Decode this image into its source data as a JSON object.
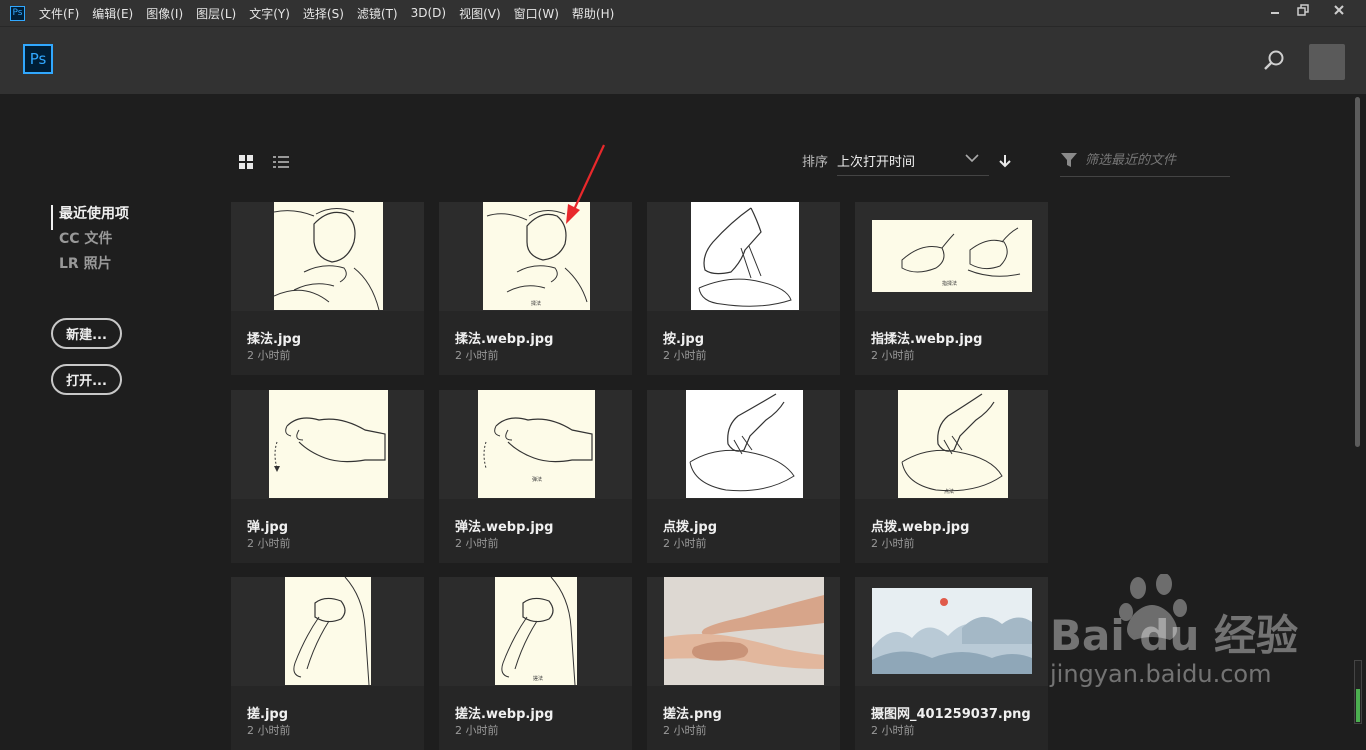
{
  "menubar": {
    "app_icon": "Ps",
    "items": [
      "文件(F)",
      "编辑(E)",
      "图像(I)",
      "图层(L)",
      "文字(Y)",
      "选择(S)",
      "滤镜(T)",
      "3D(D)",
      "视图(V)",
      "窗口(W)",
      "帮助(H)"
    ],
    "window_controls": [
      "minimize-icon",
      "restore-icon",
      "close-icon"
    ]
  },
  "header": {
    "logo": "Ps",
    "search_icon": "search-icon",
    "avatar": "user-avatar"
  },
  "sidebar": {
    "nav": [
      {
        "label": "最近使用项",
        "active": true
      },
      {
        "label": "CC 文件",
        "active": false
      },
      {
        "label": "LR 照片",
        "active": false
      }
    ],
    "new_button": "新建...",
    "open_button": "打开..."
  },
  "toolbar": {
    "view_modes": [
      "grid-view-icon",
      "list-view-icon"
    ],
    "active_view": "grid",
    "sort_label": "排序",
    "sort_value": "上次打开时间",
    "filter_placeholder": "筛选最近的文件"
  },
  "files": [
    {
      "name": "揉法.jpg",
      "time": "2 小时前"
    },
    {
      "name": "揉法.webp.jpg",
      "time": "2 小时前"
    },
    {
      "name": "按.jpg",
      "time": "2 小时前"
    },
    {
      "name": "指揉法.webp.jpg",
      "time": "2 小时前"
    },
    {
      "name": "弹.jpg",
      "time": "2 小时前"
    },
    {
      "name": "弹法.webp.jpg",
      "time": "2 小时前"
    },
    {
      "name": "点拨.jpg",
      "time": "2 小时前"
    },
    {
      "name": "点拨.webp.jpg",
      "time": "2 小时前"
    },
    {
      "name": "搓.jpg",
      "time": "2 小时前"
    },
    {
      "name": "搓法.webp.jpg",
      "time": "2 小时前"
    },
    {
      "name": "搓法.png",
      "time": "2 小时前"
    },
    {
      "name": "摄图网_401259037.png",
      "time": "2 小时前"
    }
  ],
  "thumb_captions": [
    "",
    "揉法",
    "",
    "指揉法",
    "",
    "弹法",
    "",
    "点法",
    "",
    "搓法",
    "",
    ""
  ],
  "watermark": {
    "brand": "Bai du 经验",
    "url": "jingyan.baidu.com"
  },
  "colors": {
    "accent": "#31a8ff",
    "annotation_arrow": "#e8282b"
  },
  "level_meter": 0.55
}
